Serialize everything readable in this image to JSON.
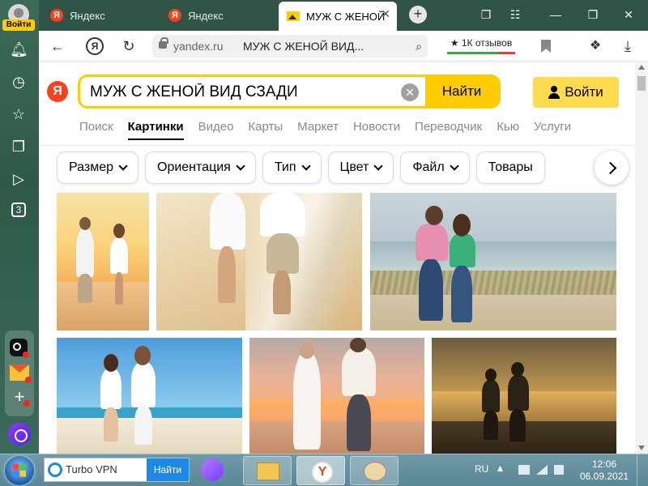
{
  "sidebar": {
    "login_label": "Войти",
    "icons": [
      "bell-icon",
      "history-icon",
      "star-icon",
      "collections-icon",
      "play-icon",
      "counter-icon"
    ],
    "counter_value": "3"
  },
  "tabs": [
    {
      "title": "Яндекс",
      "favicon": "Я"
    },
    {
      "title": "Яндекс",
      "favicon": "Я"
    },
    {
      "title": "МУЖ С ЖЕНОЙ",
      "active": true
    }
  ],
  "address_bar": {
    "domain": "yandex.ru",
    "page_title": "МУЖ С ЖЕНОЙ ВИД...",
    "reviews": "★ 1К отзывов"
  },
  "search": {
    "logo": "Я",
    "query": "МУЖ С ЖЕНОЙ ВИД СЗАДИ",
    "find_label": "Найти",
    "login_label": "Войти"
  },
  "services": [
    {
      "label": "Поиск"
    },
    {
      "label": "Картинки",
      "active": true
    },
    {
      "label": "Видео"
    },
    {
      "label": "Карты"
    },
    {
      "label": "Маркет"
    },
    {
      "label": "Новости"
    },
    {
      "label": "Переводчик"
    },
    {
      "label": "Кью"
    },
    {
      "label": "Услуги"
    }
  ],
  "filters": [
    {
      "label": "Размер",
      "dropdown": true
    },
    {
      "label": "Ориентация",
      "dropdown": true
    },
    {
      "label": "Тип",
      "dropdown": true
    },
    {
      "label": "Цвет",
      "dropdown": true
    },
    {
      "label": "Файл",
      "dropdown": true
    },
    {
      "label": "Товары",
      "dropdown": false
    }
  ],
  "taskbar": {
    "vpn_text": "Turbo VPN",
    "vpn_button": "Найти",
    "language": "RU",
    "time": "12:06",
    "date": "06.09.2021"
  },
  "colors": {
    "yandex_red": "#fc3f1d",
    "yandex_yellow": "#ffcc00",
    "sidebar_green": "#2f5446"
  }
}
